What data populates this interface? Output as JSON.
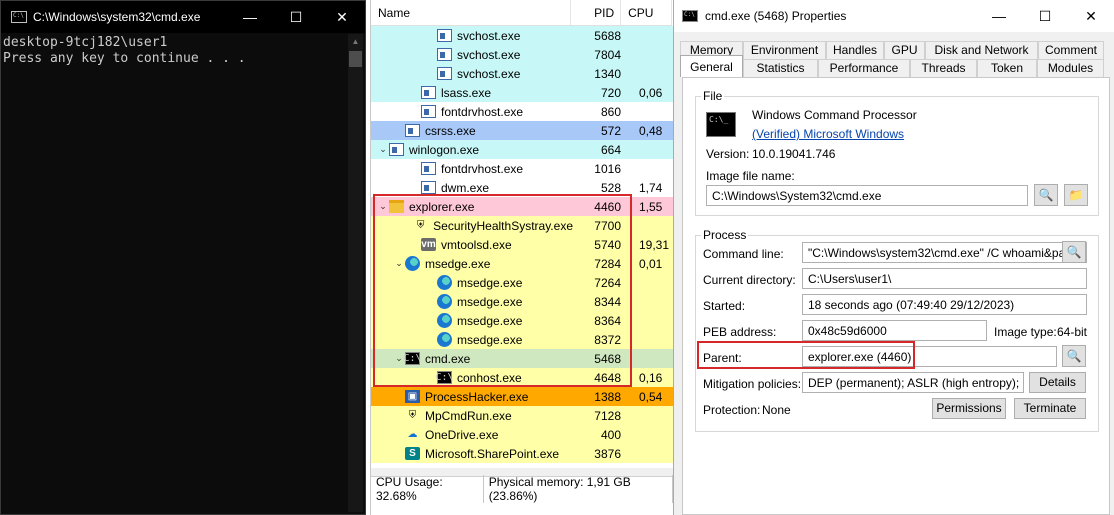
{
  "cmd_window": {
    "title": "C:\\Windows\\system32\\cmd.exe",
    "icon": "cmd-icon",
    "lines": [
      "desktop-9tcj182\\user1",
      "Press any key to continue . . ."
    ]
  },
  "process_list": {
    "columns": [
      "Name",
      "PID",
      "CPU"
    ],
    "rows": [
      {
        "name": "svchost.exe",
        "pid": "5688",
        "cpu": "",
        "icon": "window-icon",
        "indent": 3,
        "twisty": "",
        "bg": "#c8f7f7"
      },
      {
        "name": "svchost.exe",
        "pid": "7804",
        "cpu": "",
        "icon": "window-icon",
        "indent": 3,
        "twisty": "",
        "bg": "#c8f7f7"
      },
      {
        "name": "svchost.exe",
        "pid": "1340",
        "cpu": "",
        "icon": "window-icon",
        "indent": 3,
        "twisty": "",
        "bg": "#c8f7f7"
      },
      {
        "name": "lsass.exe",
        "pid": "720",
        "cpu": "0,06",
        "icon": "window-icon",
        "indent": 2,
        "twisty": "",
        "bg": "#c8f7f7"
      },
      {
        "name": "fontdrvhost.exe",
        "pid": "860",
        "cpu": "",
        "icon": "window-icon",
        "indent": 2,
        "twisty": "",
        "bg": "#ffffff"
      },
      {
        "name": "csrss.exe",
        "pid": "572",
        "cpu": "0,48",
        "icon": "window-icon",
        "indent": 1,
        "twisty": "",
        "bg": "#a8c8f8"
      },
      {
        "name": "winlogon.exe",
        "pid": "664",
        "cpu": "",
        "icon": "window-icon",
        "indent": 0,
        "twisty": "⌄",
        "bg": "#c8f7f7"
      },
      {
        "name": "fontdrvhost.exe",
        "pid": "1016",
        "cpu": "",
        "icon": "window-icon",
        "indent": 2,
        "twisty": "",
        "bg": "#ffffff"
      },
      {
        "name": "dwm.exe",
        "pid": "528",
        "cpu": "1,74",
        "icon": "window-icon",
        "indent": 2,
        "twisty": "",
        "bg": "#ffffff"
      },
      {
        "name": "explorer.exe",
        "pid": "4460",
        "cpu": "1,55",
        "icon": "folder-icon",
        "indent": 0,
        "twisty": "⌄",
        "bg": "#ffc8d8"
      },
      {
        "name": "SecurityHealthSystray.exe",
        "pid": "7700",
        "cpu": "",
        "icon": "shield-icon",
        "indent": 2,
        "twisty": "",
        "bg": "#ffffa8"
      },
      {
        "name": "vmtoolsd.exe",
        "pid": "5740",
        "cpu": "19,31",
        "icon": "vm-icon",
        "indent": 2,
        "twisty": "",
        "bg": "#ffffa8"
      },
      {
        "name": "msedge.exe",
        "pid": "7284",
        "cpu": "0,01",
        "icon": "edge-icon",
        "indent": 1,
        "twisty": "⌄",
        "bg": "#ffffa8"
      },
      {
        "name": "msedge.exe",
        "pid": "7264",
        "cpu": "",
        "icon": "edge-icon",
        "indent": 3,
        "twisty": "",
        "bg": "#ffffa8"
      },
      {
        "name": "msedge.exe",
        "pid": "8344",
        "cpu": "",
        "icon": "edge-icon",
        "indent": 3,
        "twisty": "",
        "bg": "#ffffa8"
      },
      {
        "name": "msedge.exe",
        "pid": "8364",
        "cpu": "",
        "icon": "edge-icon",
        "indent": 3,
        "twisty": "",
        "bg": "#ffffa8"
      },
      {
        "name": "msedge.exe",
        "pid": "8372",
        "cpu": "",
        "icon": "edge-icon",
        "indent": 3,
        "twisty": "",
        "bg": "#ffffa8"
      },
      {
        "name": "cmd.exe",
        "pid": "5468",
        "cpu": "",
        "icon": "cmd-icon",
        "indent": 1,
        "twisty": "⌄",
        "bg": "#d0e8c0"
      },
      {
        "name": "conhost.exe",
        "pid": "4648",
        "cpu": "0,16",
        "icon": "cmd-icon",
        "indent": 3,
        "twisty": "",
        "bg": "#ffffa8"
      },
      {
        "name": "ProcessHacker.exe",
        "pid": "1388",
        "cpu": "0,54",
        "icon": "processhacker-icon",
        "indent": 1,
        "twisty": "",
        "bg": "#ffa800"
      },
      {
        "name": "MpCmdRun.exe",
        "pid": "7128",
        "cpu": "",
        "icon": "defender-icon",
        "indent": 1,
        "twisty": "",
        "bg": "#ffffa8"
      },
      {
        "name": "OneDrive.exe",
        "pid": "400",
        "cpu": "",
        "icon": "cloud-icon",
        "indent": 1,
        "twisty": "",
        "bg": "#ffffa8"
      },
      {
        "name": "Microsoft.SharePoint.exe",
        "pid": "3876",
        "cpu": "",
        "icon": "sharepoint-icon",
        "indent": 1,
        "twisty": "",
        "bg": "#ffffa8"
      }
    ],
    "status": {
      "cpu_usage": "CPU Usage: 32.68%",
      "physical_memory": "Physical memory: 1,91 GB (23.86%)"
    }
  },
  "properties_window": {
    "title": "cmd.exe (5468) Properties",
    "tabs_row1": [
      "Memory",
      "Environment",
      "Handles",
      "GPU",
      "Disk and Network",
      "Comment"
    ],
    "tabs_row2": [
      "General",
      "Statistics",
      "Performance",
      "Threads",
      "Token",
      "Modules"
    ],
    "active_tab": "General",
    "file_group": {
      "title": "File",
      "description": "Windows Command Processor",
      "company": "(Verified) Microsoft Windows",
      "version_label": "Version:",
      "version": "10.0.19041.746",
      "image_file_label": "Image file name:",
      "image_file": "C:\\Windows\\System32\\cmd.exe"
    },
    "process_group": {
      "title": "Process",
      "command_line_label": "Command line:",
      "command_line": "\"C:\\Windows\\system32\\cmd.exe\" /C whoami&pause",
      "current_directory_label": "Current directory:",
      "current_directory": "C:\\Users\\user1\\",
      "started_label": "Started:",
      "started": "18 seconds ago (07:49:40 29/12/2023)",
      "peb_label": "PEB address:",
      "peb": "0x48c59d6000",
      "image_type_label": "Image type:",
      "image_type": "64-bit",
      "parent_label": "Parent:",
      "parent": "explorer.exe (4460)",
      "mitigation_label": "Mitigation policies:",
      "mitigation": "DEP (permanent); ASLR (high entropy); CF G",
      "details_button": "Details",
      "protection_label": "Protection:",
      "protection": "None",
      "permissions_button": "Permissions",
      "terminate_button": "Terminate"
    }
  },
  "colors": {
    "highlight_border": "#d62828",
    "link": "#0645ad"
  }
}
